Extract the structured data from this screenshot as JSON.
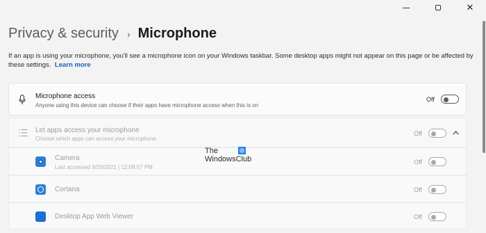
{
  "breadcrumb": {
    "parent": "Privacy & security",
    "separator": "›",
    "current": "Microphone"
  },
  "description": {
    "text": "If an app is using your microphone, you'll see a microphone icon on your Windows taskbar. Some desktop apps might not appear on this page or be affected by these settings.",
    "link": "Learn more"
  },
  "microphone_access": {
    "icon": "microphone-icon",
    "title": "Microphone access",
    "subtitle": "Anyone using this device can choose if their apps have microphone access when this is on",
    "state": "Off"
  },
  "apps_access": {
    "icon": "list-icon",
    "title": "Let apps access your microphone",
    "subtitle": "Choose which apps can access your microphone",
    "state": "Off",
    "expand_icon": "chevron-up-icon"
  },
  "apps": [
    {
      "icon": "camera-icon",
      "name": "Camera",
      "detail": "Last accessed 9/20/2021  |  12:09:57 PM",
      "state": "Off"
    },
    {
      "icon": "cortana-icon",
      "name": "Cortana",
      "detail": "",
      "state": "Off"
    },
    {
      "icon": "webview-icon",
      "name": "Desktop App Web Viewer",
      "detail": "",
      "state": "Off"
    }
  ],
  "watermark": {
    "line1": "The",
    "line2": "WindowsClub"
  },
  "colors": {
    "accent": "#1a5fb4",
    "background": "#f3f3f3",
    "card": "#fbfbfb"
  }
}
